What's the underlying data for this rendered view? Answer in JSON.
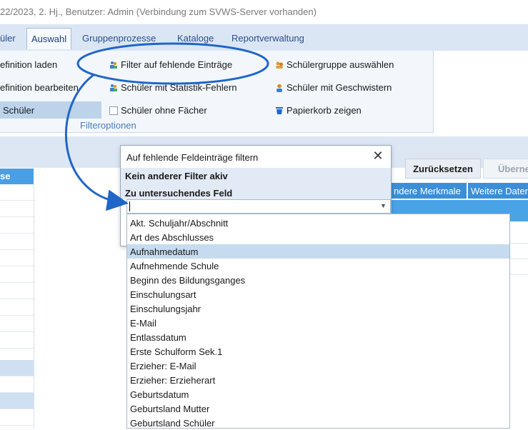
{
  "window": {
    "title": "22/2023, 2. Hj., Benutzer: Admin (Verbindung zum SVWS-Server vorhanden)"
  },
  "menu": {
    "tabs": [
      {
        "label": "üler"
      },
      {
        "label": "Auswahl"
      },
      {
        "label": "Gruppenprozesse"
      },
      {
        "label": "Kataloge"
      },
      {
        "label": "Reportverwaltung"
      }
    ]
  },
  "ribbon": {
    "left": [
      {
        "label": "efinition laden"
      },
      {
        "label": "efinition bearbeiten"
      },
      {
        "label": "Schüler"
      }
    ],
    "middle": [
      {
        "label": "Filter auf fehlende Einträge",
        "icon": "filter-people-icon"
      },
      {
        "label": "Schüler mit Statistik-Fehlern",
        "icon": "filter-people-icon"
      },
      {
        "label": "Schüler ohne Fächer",
        "icon": "checkbox-icon"
      }
    ],
    "right": [
      {
        "label": "Schülergruppe auswählen",
        "icon": "group-icon"
      },
      {
        "label": "Schüler mit Geschwistern",
        "icon": "person-icon"
      },
      {
        "label": "Papierkorb zeigen",
        "icon": "trash-icon"
      }
    ],
    "group_label": "Filteroptionen"
  },
  "sidebar": {
    "header": "se"
  },
  "toolbar": {
    "reset_label": "Zurücksetzen",
    "apply_label": "Überne"
  },
  "subtabs": [
    {
      "label": "ndere Merkmale"
    },
    {
      "label": "Weitere Daten"
    }
  ],
  "dialog": {
    "title": "Auf fehlende Feldeinträge filtern",
    "close_icon": "close-icon",
    "status": "Kein anderer Filter akiv",
    "field_label": "Zu untersuchendes Feld",
    "combo_value": ""
  },
  "dropdown": {
    "selected_index": 2,
    "options": [
      "Akt. Schuljahr/Abschnitt",
      "Art des Abschlusses",
      "Aufnahmedatum",
      "Aufnehmende Schule",
      "Beginn des Bildungsganges",
      "Einschulungsart",
      "Einschulungsjahr",
      "E-Mail",
      "Entlassdatum",
      "Erste Schulform Sek.1",
      "Erzieher: E-Mail",
      "Erzieher: Erzieherart",
      "Geburtsdatum",
      "Geburtsland Mutter",
      "Geburtsland Schüler"
    ]
  },
  "colors": {
    "accent": "#1f66c9",
    "selection": "#c6dbef",
    "header_blue": "#4aa3e6"
  }
}
